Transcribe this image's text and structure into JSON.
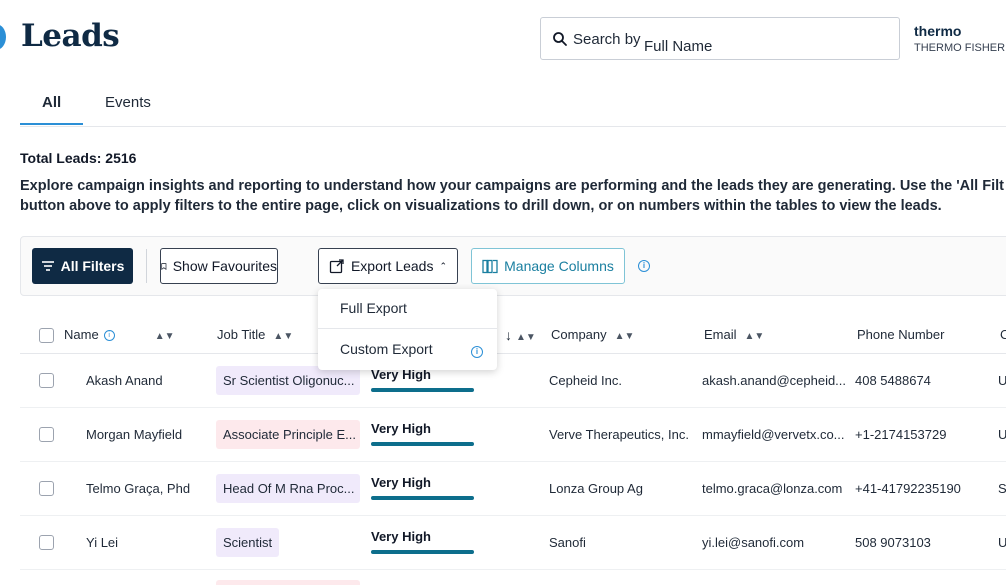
{
  "header": {
    "title": "Leads",
    "search": {
      "prefix": "Search by",
      "value": "Full Name"
    },
    "account": {
      "name": "thermo",
      "org": "THERMO FISHER S"
    }
  },
  "tabs": [
    {
      "label": "All"
    },
    {
      "label": "Events"
    }
  ],
  "summary": {
    "total": "Total Leads: 2516",
    "line1": "Explore campaign insights and reporting to understand how your campaigns are performing and the leads they are generating. Use the 'All Filt",
    "line2": "button above to apply filters to the entire page, click on visualizations to drill down, or on numbers within the tables to view the leads."
  },
  "toolbar": {
    "all_filters": "All Filters",
    "show_favourites": "Show Favourites",
    "export_leads": "Export Leads",
    "manage_columns": "Manage Columns"
  },
  "export_menu": [
    {
      "label": "Full Export"
    },
    {
      "label": "Custom Export"
    }
  ],
  "table": {
    "columns": {
      "name": "Name",
      "job_title": "Job Title",
      "company": "Company",
      "email": "Email",
      "phone": "Phone Number",
      "extra": "C"
    },
    "rows": [
      {
        "name": "Akash Anand",
        "job": "Sr Scientist Oligonuc...",
        "score": "Very High",
        "company": "Cepheid Inc.",
        "email": "akash.anand@cepheid...",
        "phone": "408 5488674",
        "extra": "U"
      },
      {
        "name": "Morgan Mayfield",
        "job": "Associate Principle E...",
        "score": "Very High",
        "company": "Verve Therapeutics, Inc.",
        "email": "mmayfield@vervetx.co...",
        "phone": "+1-2174153729",
        "extra": "U"
      },
      {
        "name": "Telmo Graça, Phd",
        "job": "Head Of M Rna Proc...",
        "score": "Very High",
        "company": "Lonza Group Ag",
        "email": "telmo.graca@lonza.com",
        "phone": "+41-41792235190",
        "extra": "S"
      },
      {
        "name": "Yi Lei",
        "job": "Scientist",
        "score": "Very High",
        "company": "Sanofi",
        "email": "yi.lei@sanofi.com",
        "phone": "508 9073103",
        "extra": "U"
      }
    ]
  }
}
